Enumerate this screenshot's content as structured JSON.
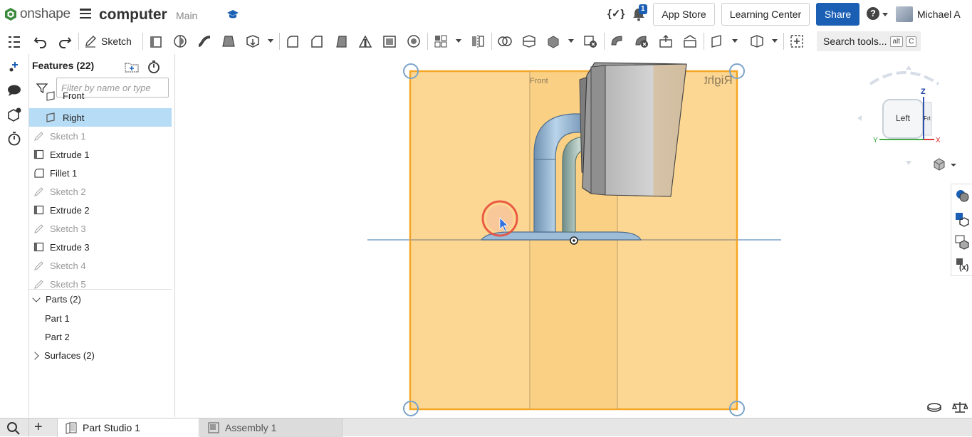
{
  "header": {
    "logo_text": "onshape",
    "document_title": "computer",
    "branch": "Main",
    "notification_count": "1",
    "app_store_label": "App Store",
    "learning_center_label": "Learning Center",
    "share_label": "Share",
    "help_label": "?",
    "user_name": "Michael A"
  },
  "toolbar": {
    "sketch_label": "Sketch",
    "search_label": "Search tools...",
    "search_key_1": "alt",
    "search_key_2": "C"
  },
  "features_panel": {
    "title": "Features (22)",
    "filter_placeholder": "Filter by name or type",
    "items": [
      {
        "label": "Front",
        "icon": "plane-icon",
        "state": "normal"
      },
      {
        "label": "Right",
        "icon": "plane-icon",
        "state": "selected"
      },
      {
        "label": "Sketch 1",
        "icon": "sketch-icon",
        "state": "dim"
      },
      {
        "label": "Extrude 1",
        "icon": "extrude-icon",
        "state": "normal"
      },
      {
        "label": "Fillet 1",
        "icon": "fillet-icon",
        "state": "normal"
      },
      {
        "label": "Sketch 2",
        "icon": "sketch-icon",
        "state": "dim"
      },
      {
        "label": "Extrude 2",
        "icon": "extrude-icon",
        "state": "normal"
      },
      {
        "label": "Sketch 3",
        "icon": "sketch-icon",
        "state": "dim"
      },
      {
        "label": "Extrude 3",
        "icon": "extrude-icon",
        "state": "normal"
      },
      {
        "label": "Sketch 4",
        "icon": "sketch-icon",
        "state": "dim"
      },
      {
        "label": "Sketch 5",
        "icon": "sketch-icon",
        "state": "dim"
      }
    ],
    "parts_label": "Parts (2)",
    "parts": [
      "Part 1",
      "Part 2"
    ],
    "surfaces_label": "Surfaces (2)"
  },
  "viewport": {
    "plane_front_label": "Front",
    "plane_right_label": "Right",
    "plane_color": "#f5a623",
    "view_cube": {
      "face_label": "Left",
      "side_label": "Frt",
      "axis_z": "Z",
      "axis_y": "Y",
      "axis_x": "X"
    }
  },
  "tabs": {
    "part_studio_label": "Part Studio 1",
    "assembly_label": "Assembly 1"
  },
  "colors": {
    "accent_blue": "#1a5fb4",
    "selection_blue": "#b7dcf5",
    "plane_fill": "#fcd48a"
  }
}
